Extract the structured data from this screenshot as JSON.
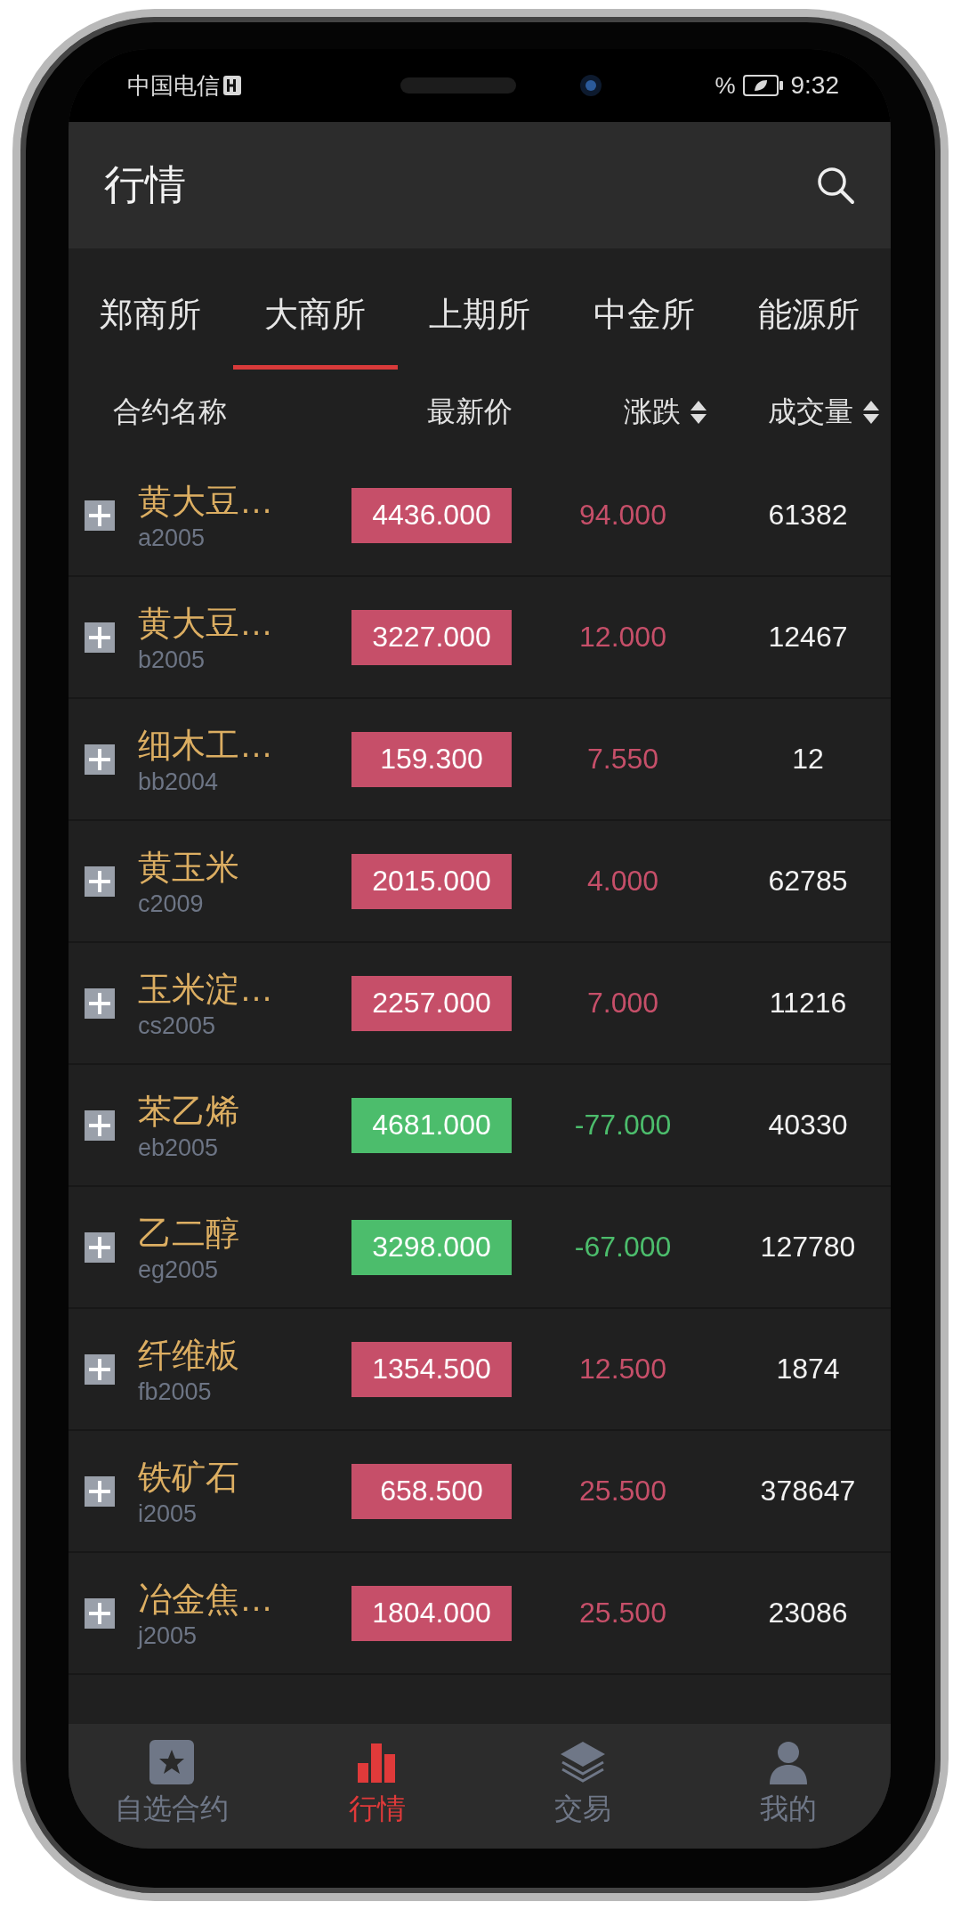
{
  "status_bar": {
    "carrier": "中国电信",
    "battery_percent": "%",
    "time": "9:32"
  },
  "header": {
    "title": "行情"
  },
  "tabs": [
    {
      "label": "郑商所",
      "selected": false
    },
    {
      "label": "大商所",
      "selected": true
    },
    {
      "label": "上期所",
      "selected": false
    },
    {
      "label": "中金所",
      "selected": false
    },
    {
      "label": "能源所",
      "selected": false
    }
  ],
  "table": {
    "columns": [
      {
        "label": "合约名称",
        "sortable": false
      },
      {
        "label": "最新价",
        "sortable": false
      },
      {
        "label": "涨跌",
        "sortable": true
      },
      {
        "label": "成交量",
        "sortable": true
      }
    ],
    "rows": [
      {
        "name": "黄大豆…",
        "code": "a2005",
        "price": "4436.000",
        "change": "94.000",
        "volume": "61382",
        "kind": "up"
      },
      {
        "name": "黄大豆…",
        "code": "b2005",
        "price": "3227.000",
        "change": "12.000",
        "volume": "12467",
        "kind": "up"
      },
      {
        "name": "细木工…",
        "code": "bb2004",
        "price": "159.300",
        "change": "7.550",
        "volume": "12",
        "kind": "up"
      },
      {
        "name": "黄玉米",
        "code": "c2009",
        "price": "2015.000",
        "change": "4.000",
        "volume": "62785",
        "kind": "up"
      },
      {
        "name": "玉米淀…",
        "code": "cs2005",
        "price": "2257.000",
        "change": "7.000",
        "volume": "11216",
        "kind": "up"
      },
      {
        "name": "苯乙烯",
        "code": "eb2005",
        "price": "4681.000",
        "change": "-77.000",
        "volume": "40330",
        "kind": "down"
      },
      {
        "name": "乙二醇",
        "code": "eg2005",
        "price": "3298.000",
        "change": "-67.000",
        "volume": "127780",
        "kind": "down"
      },
      {
        "name": "纤维板",
        "code": "fb2005",
        "price": "1354.500",
        "change": "12.500",
        "volume": "1874",
        "kind": "up"
      },
      {
        "name": "铁矿石",
        "code": "i2005",
        "price": "658.500",
        "change": "25.500",
        "volume": "378647",
        "kind": "up"
      },
      {
        "name": "冶金焦…",
        "code": "j2005",
        "price": "1804.000",
        "change": "25.500",
        "volume": "23086",
        "kind": "up"
      }
    ]
  },
  "bottom_nav": [
    {
      "label": "自选合约",
      "kind": "watchlist",
      "selected": false
    },
    {
      "label": "行情",
      "kind": "market",
      "selected": true
    },
    {
      "label": "交易",
      "kind": "trade",
      "selected": false
    },
    {
      "label": "我的",
      "kind": "profile",
      "selected": false
    }
  ]
}
